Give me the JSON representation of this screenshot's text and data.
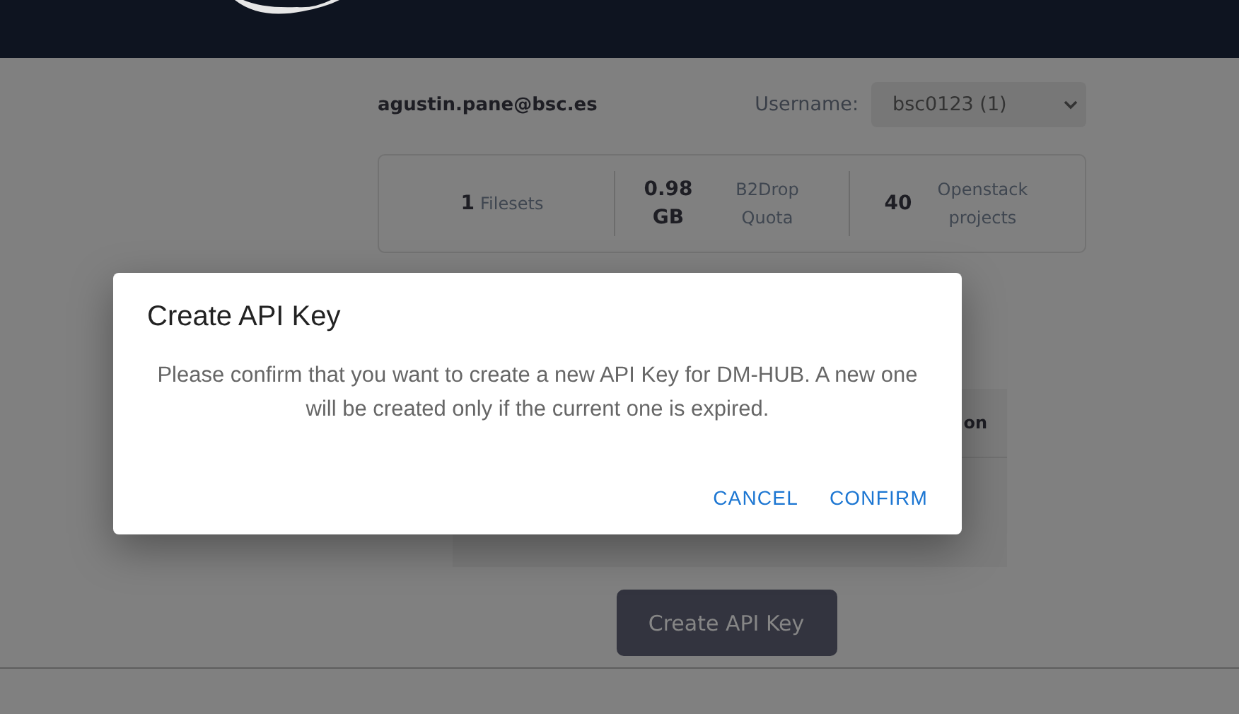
{
  "account": {
    "email": "agustin.pane@bsc.es",
    "username_label": "Username:",
    "username_value": "bsc0123 (1)"
  },
  "stats": [
    {
      "value": "1",
      "label": "Filesets"
    },
    {
      "value": "0.98 GB",
      "label": "B2Drop Quota"
    },
    {
      "value": "40",
      "label": "Openstack projects"
    }
  ],
  "table": {
    "column_header": "on"
  },
  "create_button": "Create API Key",
  "dialog": {
    "title": "Create API Key",
    "message": "Please confirm that you want to create a new API Key for DM-HUB. A new one will be created only if the current one is expired.",
    "buttons": [
      "CANCEL",
      "CONFIRM"
    ]
  }
}
